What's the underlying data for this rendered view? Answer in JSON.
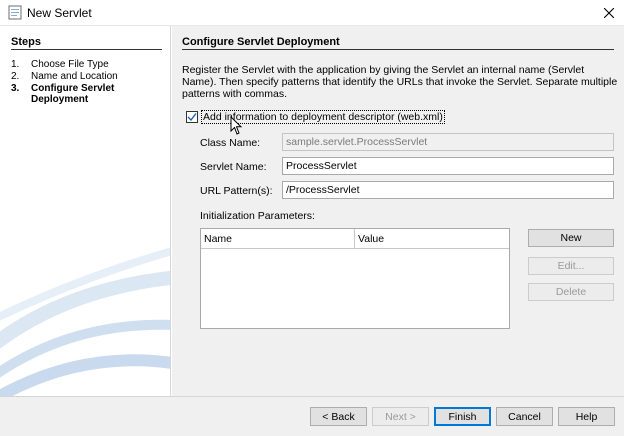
{
  "window": {
    "title": "New Servlet",
    "icon": "netbeans-app-icon",
    "close_icon": "close-icon"
  },
  "steps": {
    "heading": "Steps",
    "items": [
      {
        "num": "1.",
        "label": "Choose File Type",
        "current": false
      },
      {
        "num": "2.",
        "label": "Name and Location",
        "current": false
      },
      {
        "num": "3.",
        "label": "Configure Servlet Deployment",
        "current": true
      }
    ]
  },
  "panel": {
    "title": "Configure Servlet Deployment",
    "description": "Register the Servlet with the application by giving the Servlet an internal name (Servlet Name). Then specify patterns that identify the URLs that invoke the Servlet. Separate multiple patterns with commas.",
    "checkbox_label": "Add information to deployment descriptor (web.xml)",
    "checkbox_checked": true,
    "class_name_label": "Class Name:",
    "class_name_value": "sample.servlet.ProcessServlet",
    "servlet_name_label": "Servlet Name:",
    "servlet_name_value": "ProcessServlet",
    "url_pattern_label": "URL Pattern(s):",
    "url_pattern_value": "/ProcessServlet",
    "init_params_label": "Initialization Parameters:",
    "table_columns": [
      "Name",
      "Value"
    ],
    "new_button": "New",
    "edit_button": "Edit...",
    "delete_button": "Delete"
  },
  "footer": {
    "back": "< Back",
    "next": "Next >",
    "finish": "Finish",
    "cancel": "Cancel",
    "help": "Help"
  },
  "colors": {
    "accent": "#0078d7",
    "panel_bg": "#f0f0f0"
  }
}
